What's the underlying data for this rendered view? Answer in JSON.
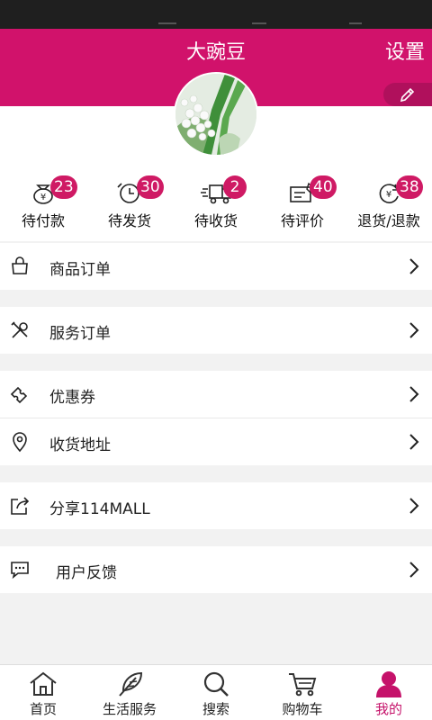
{
  "header": {
    "title": "大豌豆",
    "settings_label": "设置",
    "accent": "#d1126b"
  },
  "orders": [
    {
      "label": "待付款",
      "count": "23",
      "icon": "money-bag-icon"
    },
    {
      "label": "待发货",
      "count": "30",
      "icon": "alarm-clock-icon"
    },
    {
      "label": "待收货",
      "count": "2",
      "icon": "delivery-truck-icon"
    },
    {
      "label": "待评价",
      "count": "40",
      "icon": "comment-card-icon"
    },
    {
      "label": "退货/退款",
      "count": "38",
      "icon": "refund-icon"
    }
  ],
  "menu": [
    {
      "label": "商品订单",
      "icon": "shopping-bag-icon"
    },
    {
      "label": "服务订单",
      "icon": "tools-icon"
    },
    {
      "label": "优惠券",
      "icon": "coupon-icon"
    },
    {
      "label": "收货地址",
      "icon": "location-pin-icon"
    },
    {
      "label": "分享114MALL",
      "icon": "share-icon"
    },
    {
      "label": "用户反馈",
      "icon": "feedback-icon"
    }
  ],
  "tabs": [
    {
      "label": "首页",
      "icon": "home-icon"
    },
    {
      "label": "生活服务",
      "icon": "feather-icon"
    },
    {
      "label": "搜索",
      "icon": "search-icon"
    },
    {
      "label": "购物车",
      "icon": "cart-icon"
    },
    {
      "label": "我的",
      "icon": "user-icon",
      "active": true
    }
  ]
}
